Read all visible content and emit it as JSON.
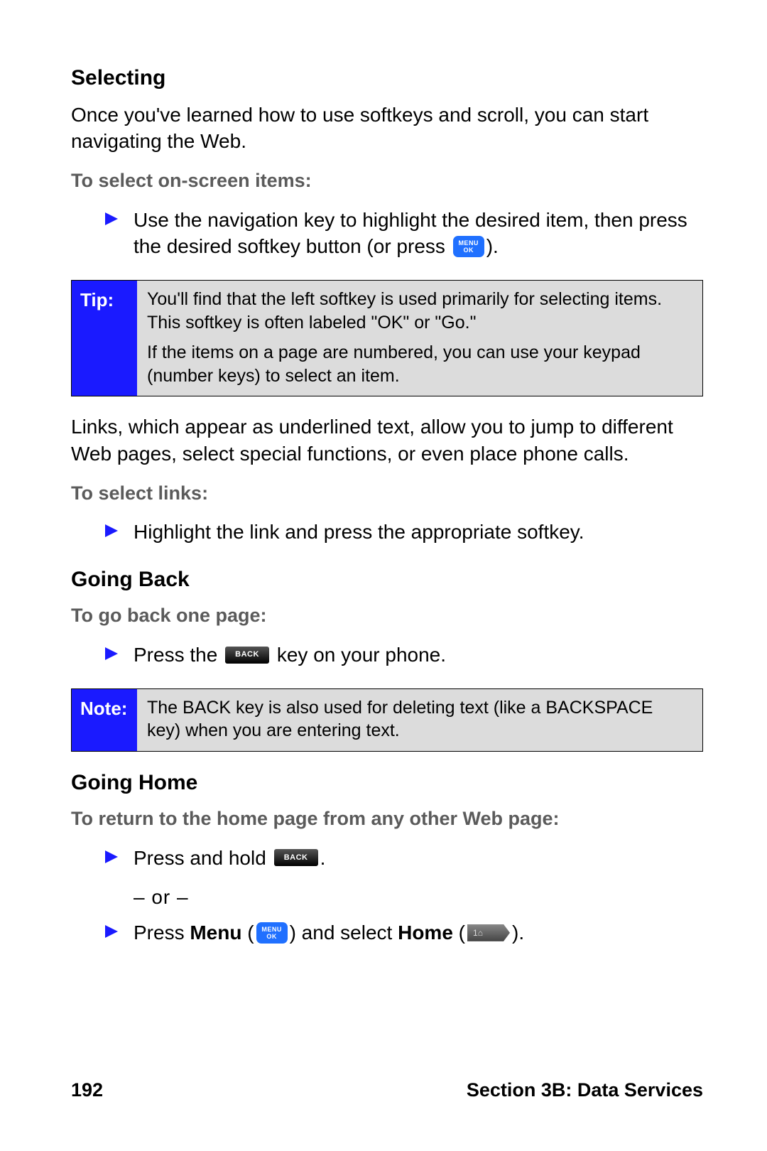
{
  "h_selecting": "Selecting",
  "p_intro": "Once you've learned how to use softkeys and scroll, you can start navigating the Web.",
  "sub_select_items": "To select on-screen items:",
  "b_select_items_pre": "Use the navigation key to highlight the desired item, then press the desired softkey button (or press ",
  "b_select_items_post": ").",
  "tip_label": "Tip:",
  "tip_p1": "You'll find that the left softkey is used primarily for selecting items. This softkey is often labeled \"OK\" or \"Go.\"",
  "tip_p2": "If the items on a page are numbered, you can use your keypad (number keys) to select an item.",
  "p_links": "Links, which appear as underlined text, allow you to jump to different Web pages, select special functions, or even place phone calls.",
  "sub_select_links": "To select links:",
  "b_select_links": "Highlight the link and press the appropriate softkey.",
  "h_goingback": "Going Back",
  "sub_goback": "To go back one page:",
  "b_goback_pre": "Press the ",
  "b_goback_post": " key on your phone.",
  "note_label": "Note:",
  "note_p1": "The BACK key is also used for deleting text (like a BACKSPACE key) when you are entering text.",
  "h_goinghome": "Going Home",
  "sub_gohome": "To return to the home page from any other Web page:",
  "b_home1_pre": "Press and hold ",
  "b_home1_post": ".",
  "or_text": "– or –",
  "b_home2_pre": "Press ",
  "b_home2_menu": "Menu",
  "b_home2_mid": " (",
  "b_home2_mid2": ") and select ",
  "b_home2_home": "Home",
  "b_home2_mid3": " (",
  "b_home2_post": ").",
  "menuok_l1": "MENU",
  "menuok_l2": "OK",
  "back_label": "BACK",
  "page_num": "192",
  "section": "Section 3B: Data Services"
}
